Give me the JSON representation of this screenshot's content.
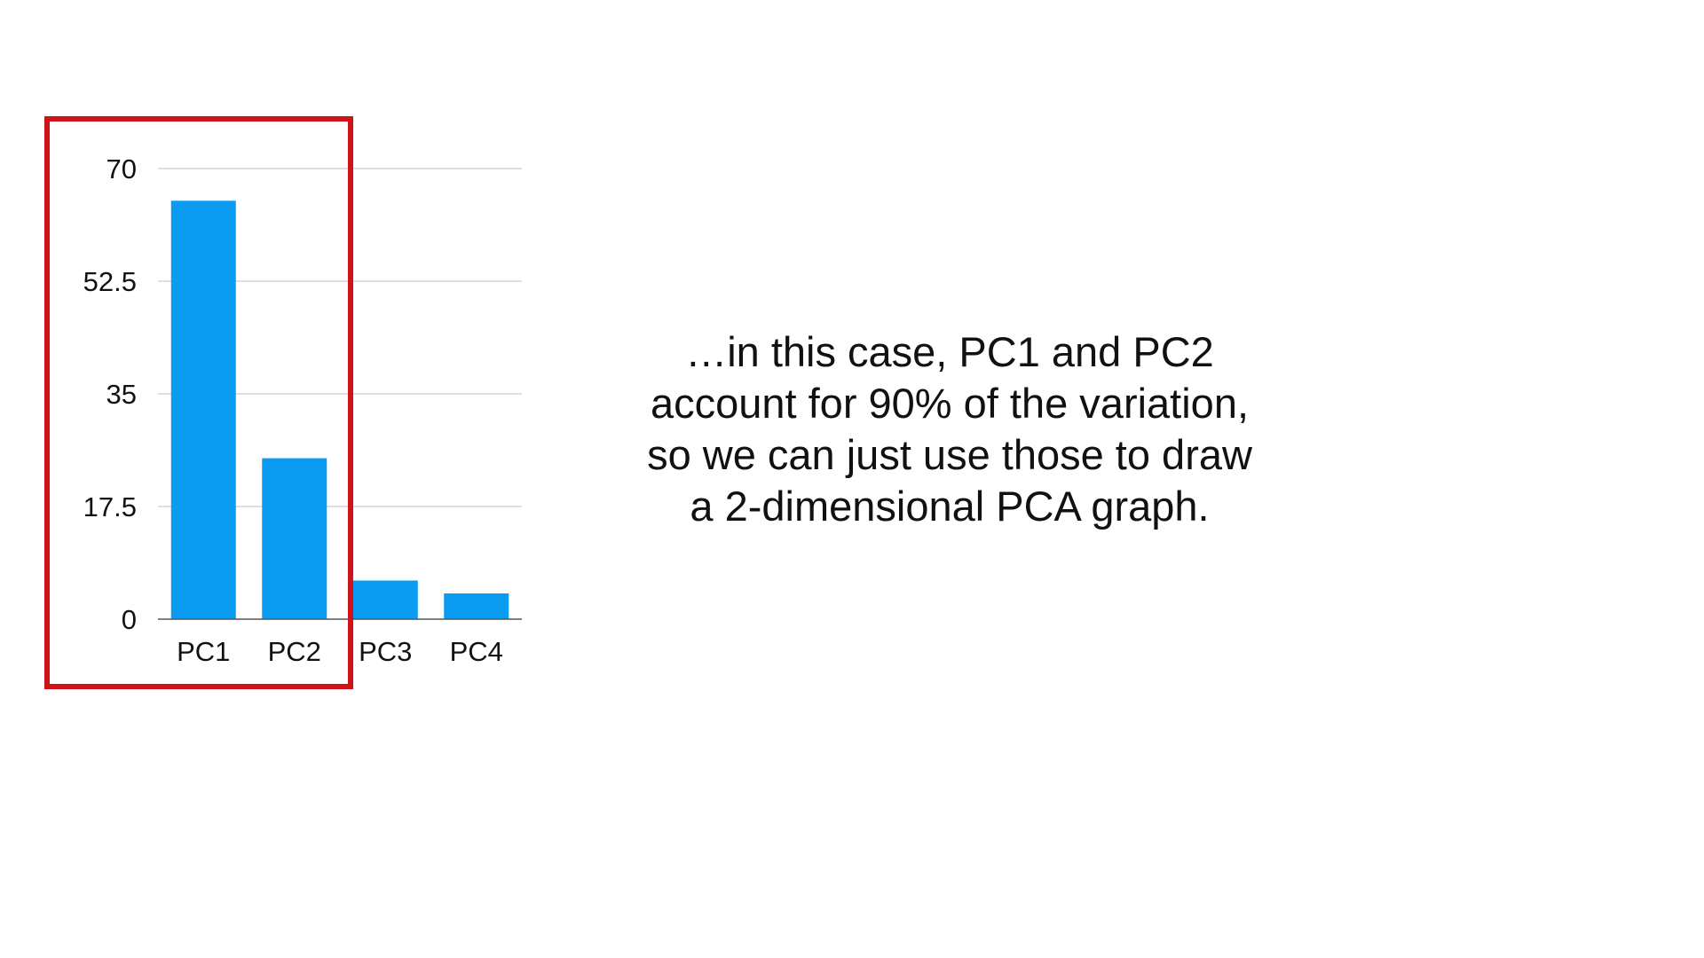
{
  "caption": {
    "lines": [
      "…in this case, PC1 and PC2",
      "account for 90% of the variation,",
      "so we can just use those to draw",
      "a 2-dimensional PCA graph."
    ]
  },
  "highlight": {
    "color": "#d0121b",
    "covers_categories": [
      "PC1",
      "PC2"
    ]
  },
  "chart_data": {
    "type": "bar",
    "categories": [
      "PC1",
      "PC2",
      "PC3",
      "PC4"
    ],
    "values": [
      65,
      25,
      6,
      4
    ],
    "yticks": [
      0,
      17.5,
      35,
      52.5,
      70
    ],
    "ylim": [
      0,
      70
    ],
    "title": "",
    "xlabel": "",
    "ylabel": "",
    "grid": true,
    "bar_color": "#0b9cf2",
    "grid_color": "#cccccc",
    "axis_color": "#555555"
  }
}
